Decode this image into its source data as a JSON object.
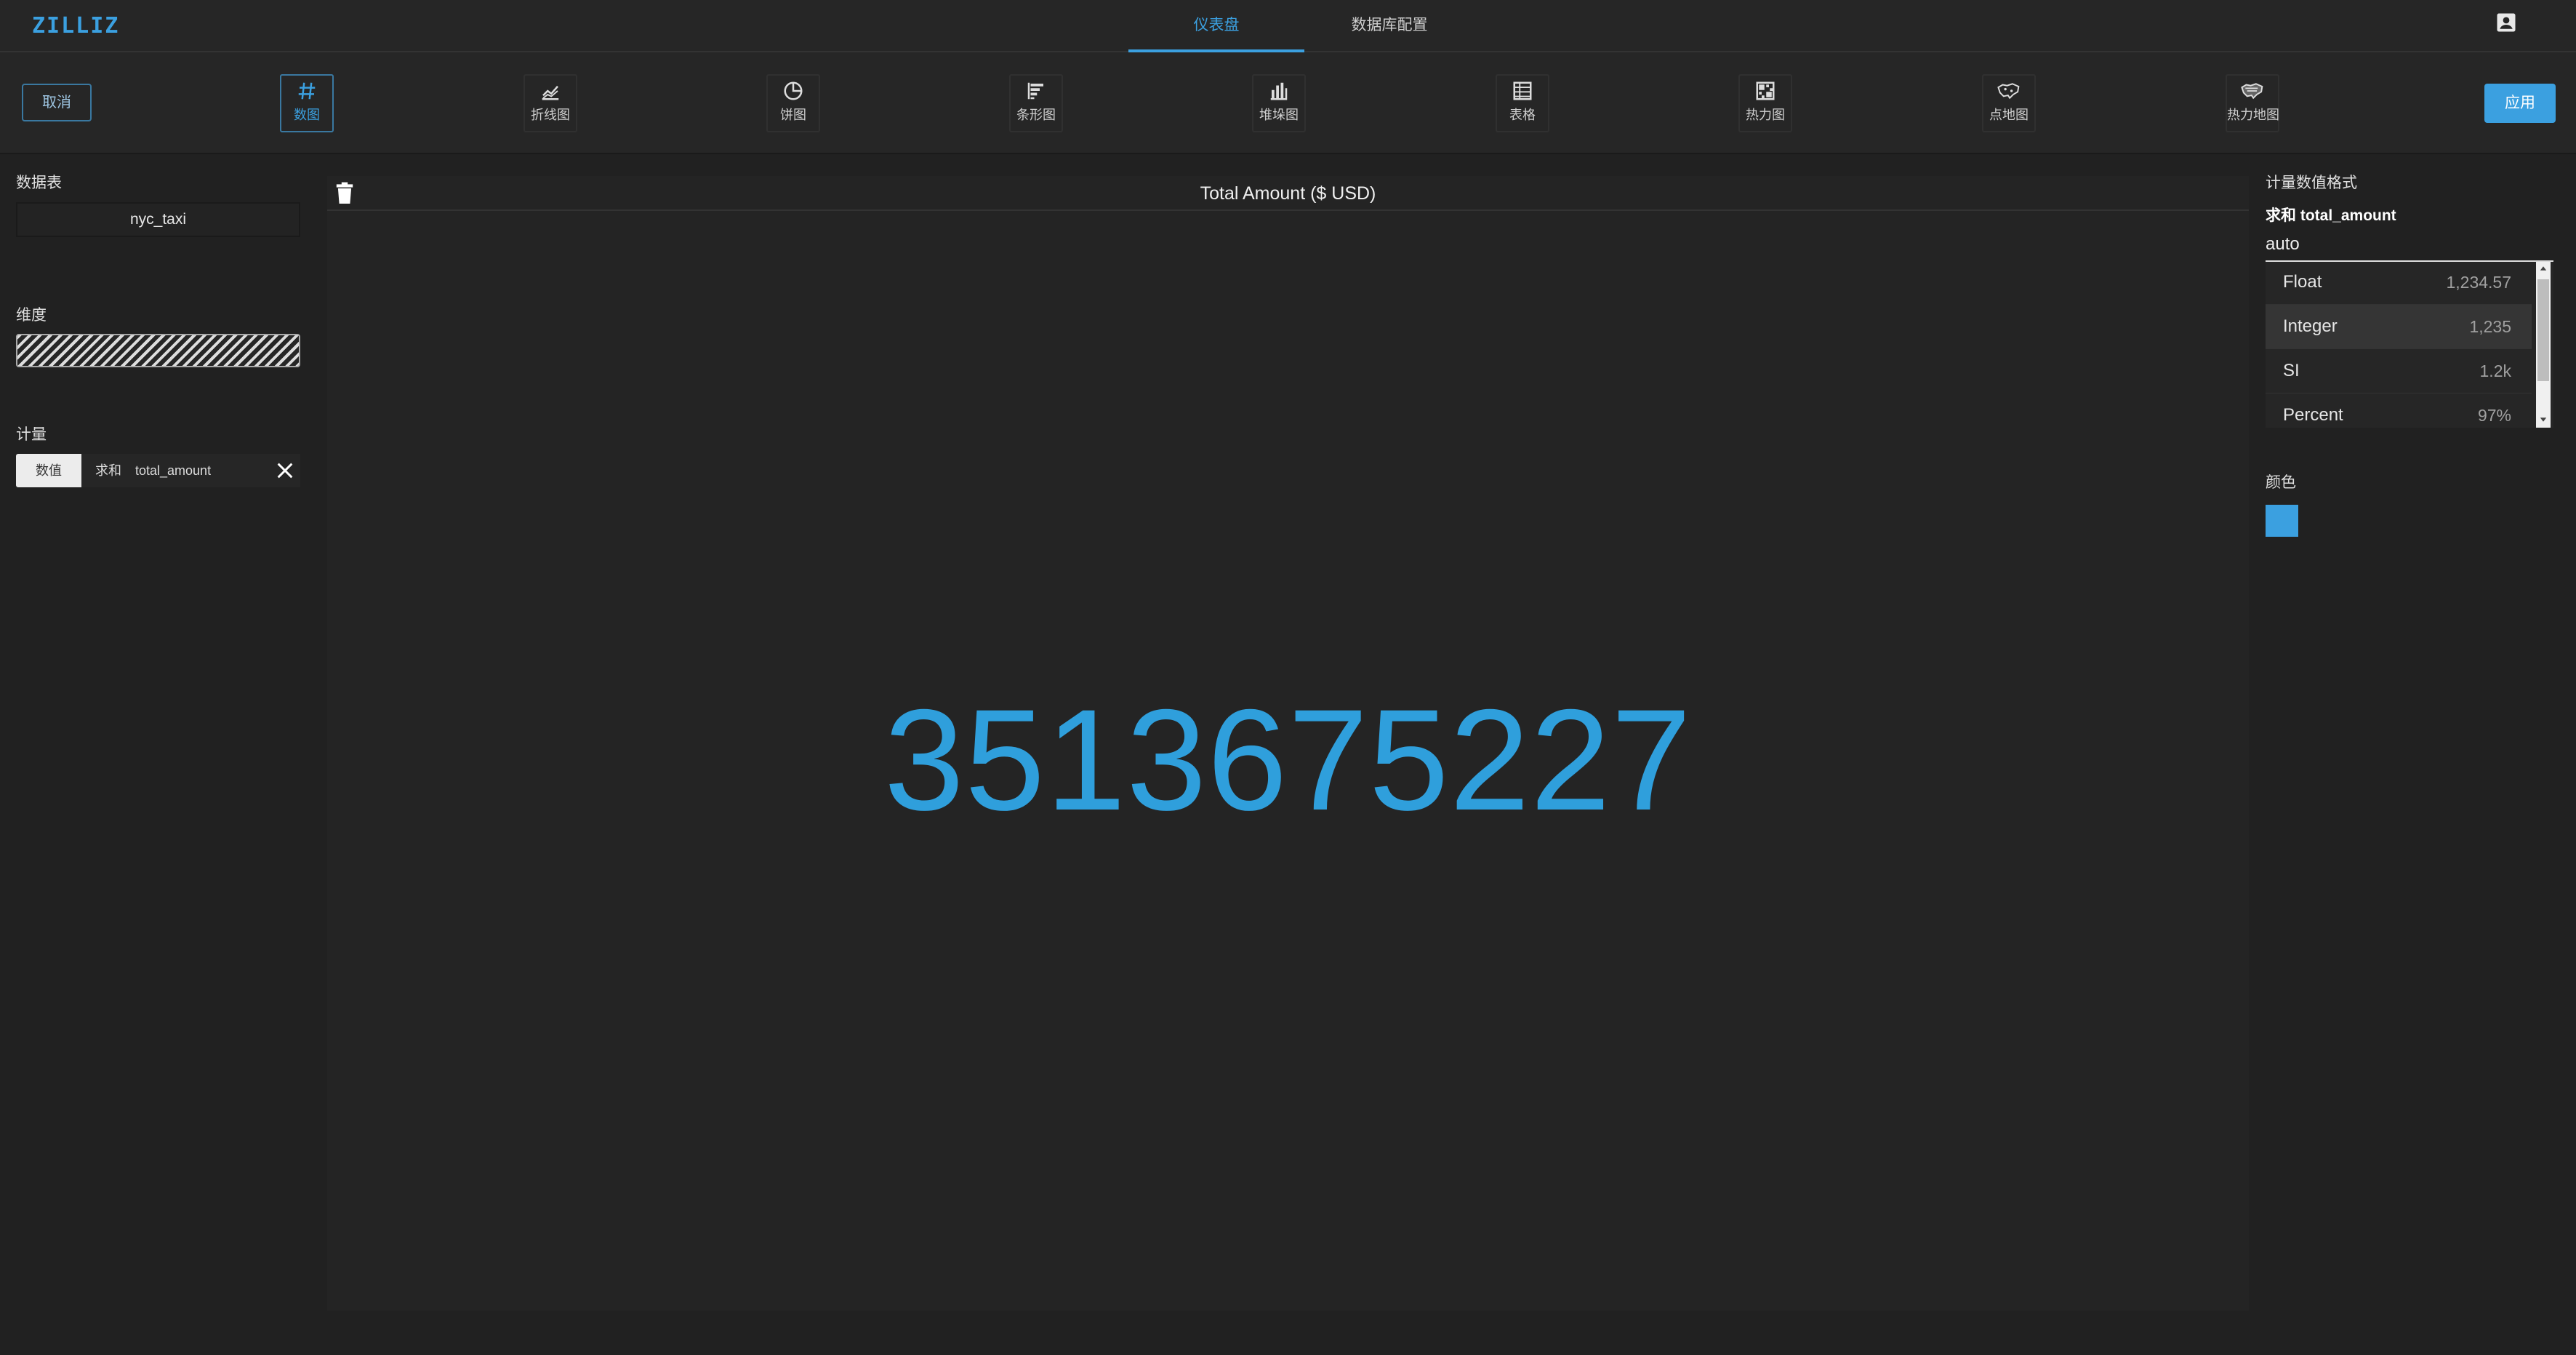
{
  "app": {
    "logo": "ZILLIZ"
  },
  "nav": {
    "tabs": [
      {
        "label": "仪表盘"
      },
      {
        "label": "数据库配置"
      }
    ]
  },
  "toolbar": {
    "cancel_label": "取消",
    "apply_label": "应用",
    "chart_types": [
      {
        "label": "数图",
        "icon": "hash-icon",
        "selected": true
      },
      {
        "label": "折线图",
        "icon": "line-chart-icon"
      },
      {
        "label": "饼图",
        "icon": "pie-chart-icon"
      },
      {
        "label": "条形图",
        "icon": "bar-chart-icon"
      },
      {
        "label": "堆垛图",
        "icon": "stacked-chart-icon"
      },
      {
        "label": "表格",
        "icon": "table-icon"
      },
      {
        "label": "热力图",
        "icon": "heatmap-icon"
      },
      {
        "label": "点地图",
        "icon": "point-map-icon"
      },
      {
        "label": "热力地图",
        "icon": "heat-map-icon"
      }
    ]
  },
  "left_panel": {
    "table_title": "数据表",
    "table_value": "nyc_taxi",
    "dimension_title": "维度",
    "measure_title": "计量",
    "measure": {
      "type_label": "数值",
      "aggregation": "求和",
      "field": "total_amount"
    }
  },
  "chart": {
    "title": "Total Amount ($ USD)",
    "value": "3513675227"
  },
  "right_panel": {
    "format_title": "计量数值格式",
    "measure_name": "求和 total_amount",
    "selected_format": "auto",
    "formats": [
      {
        "name": "Float",
        "example": "1,234.57"
      },
      {
        "name": "Integer",
        "example": "1,235"
      },
      {
        "name": "SI",
        "example": "1.2k"
      },
      {
        "name": "Percent",
        "example": "97%"
      }
    ],
    "color_title": "颜色",
    "color_value": "#3ba0e0"
  },
  "colors": {
    "accent": "#3ba0e0",
    "background": "#212121"
  }
}
